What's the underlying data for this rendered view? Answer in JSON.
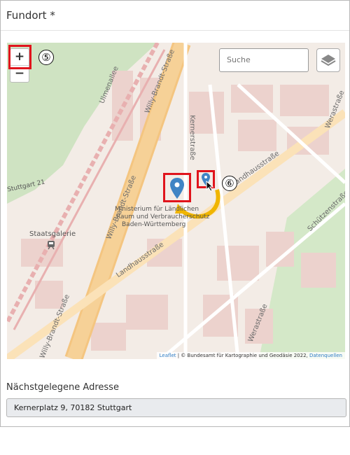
{
  "panel": {
    "title": "Fundort *"
  },
  "map": {
    "zoom_in": "+",
    "zoom_out": "−",
    "search_placeholder": "Suche",
    "callouts": {
      "zoom": "⑤",
      "marker": "⑥"
    },
    "streets": [
      "Willy-Brandt-Straße",
      "Willy-Brandt-Straße",
      "Willy-Brandt-Straße",
      "Ulmenallee",
      "Kernerstraße",
      "Landhausstraße",
      "Landhausstraße",
      "Schützenstraße",
      "Werastraße",
      "Werastraße"
    ],
    "labels": {
      "station": "Stuttgart 21",
      "museum": "Staatsgalerie",
      "ministry": [
        "Ministerium für Ländlichen",
        "Raum und Verbraucherschutz",
        "Baden-Württemberg"
      ]
    },
    "attribution": {
      "leaflet": "Leaflet",
      "text": " | © Bundesamt für Kartographie und Geodäsie 2022, ",
      "sources": "Datenquellen"
    }
  },
  "address": {
    "label": "Nächstgelegene Adresse",
    "value": "Kernerplatz 9, 70182 Stuttgart"
  }
}
